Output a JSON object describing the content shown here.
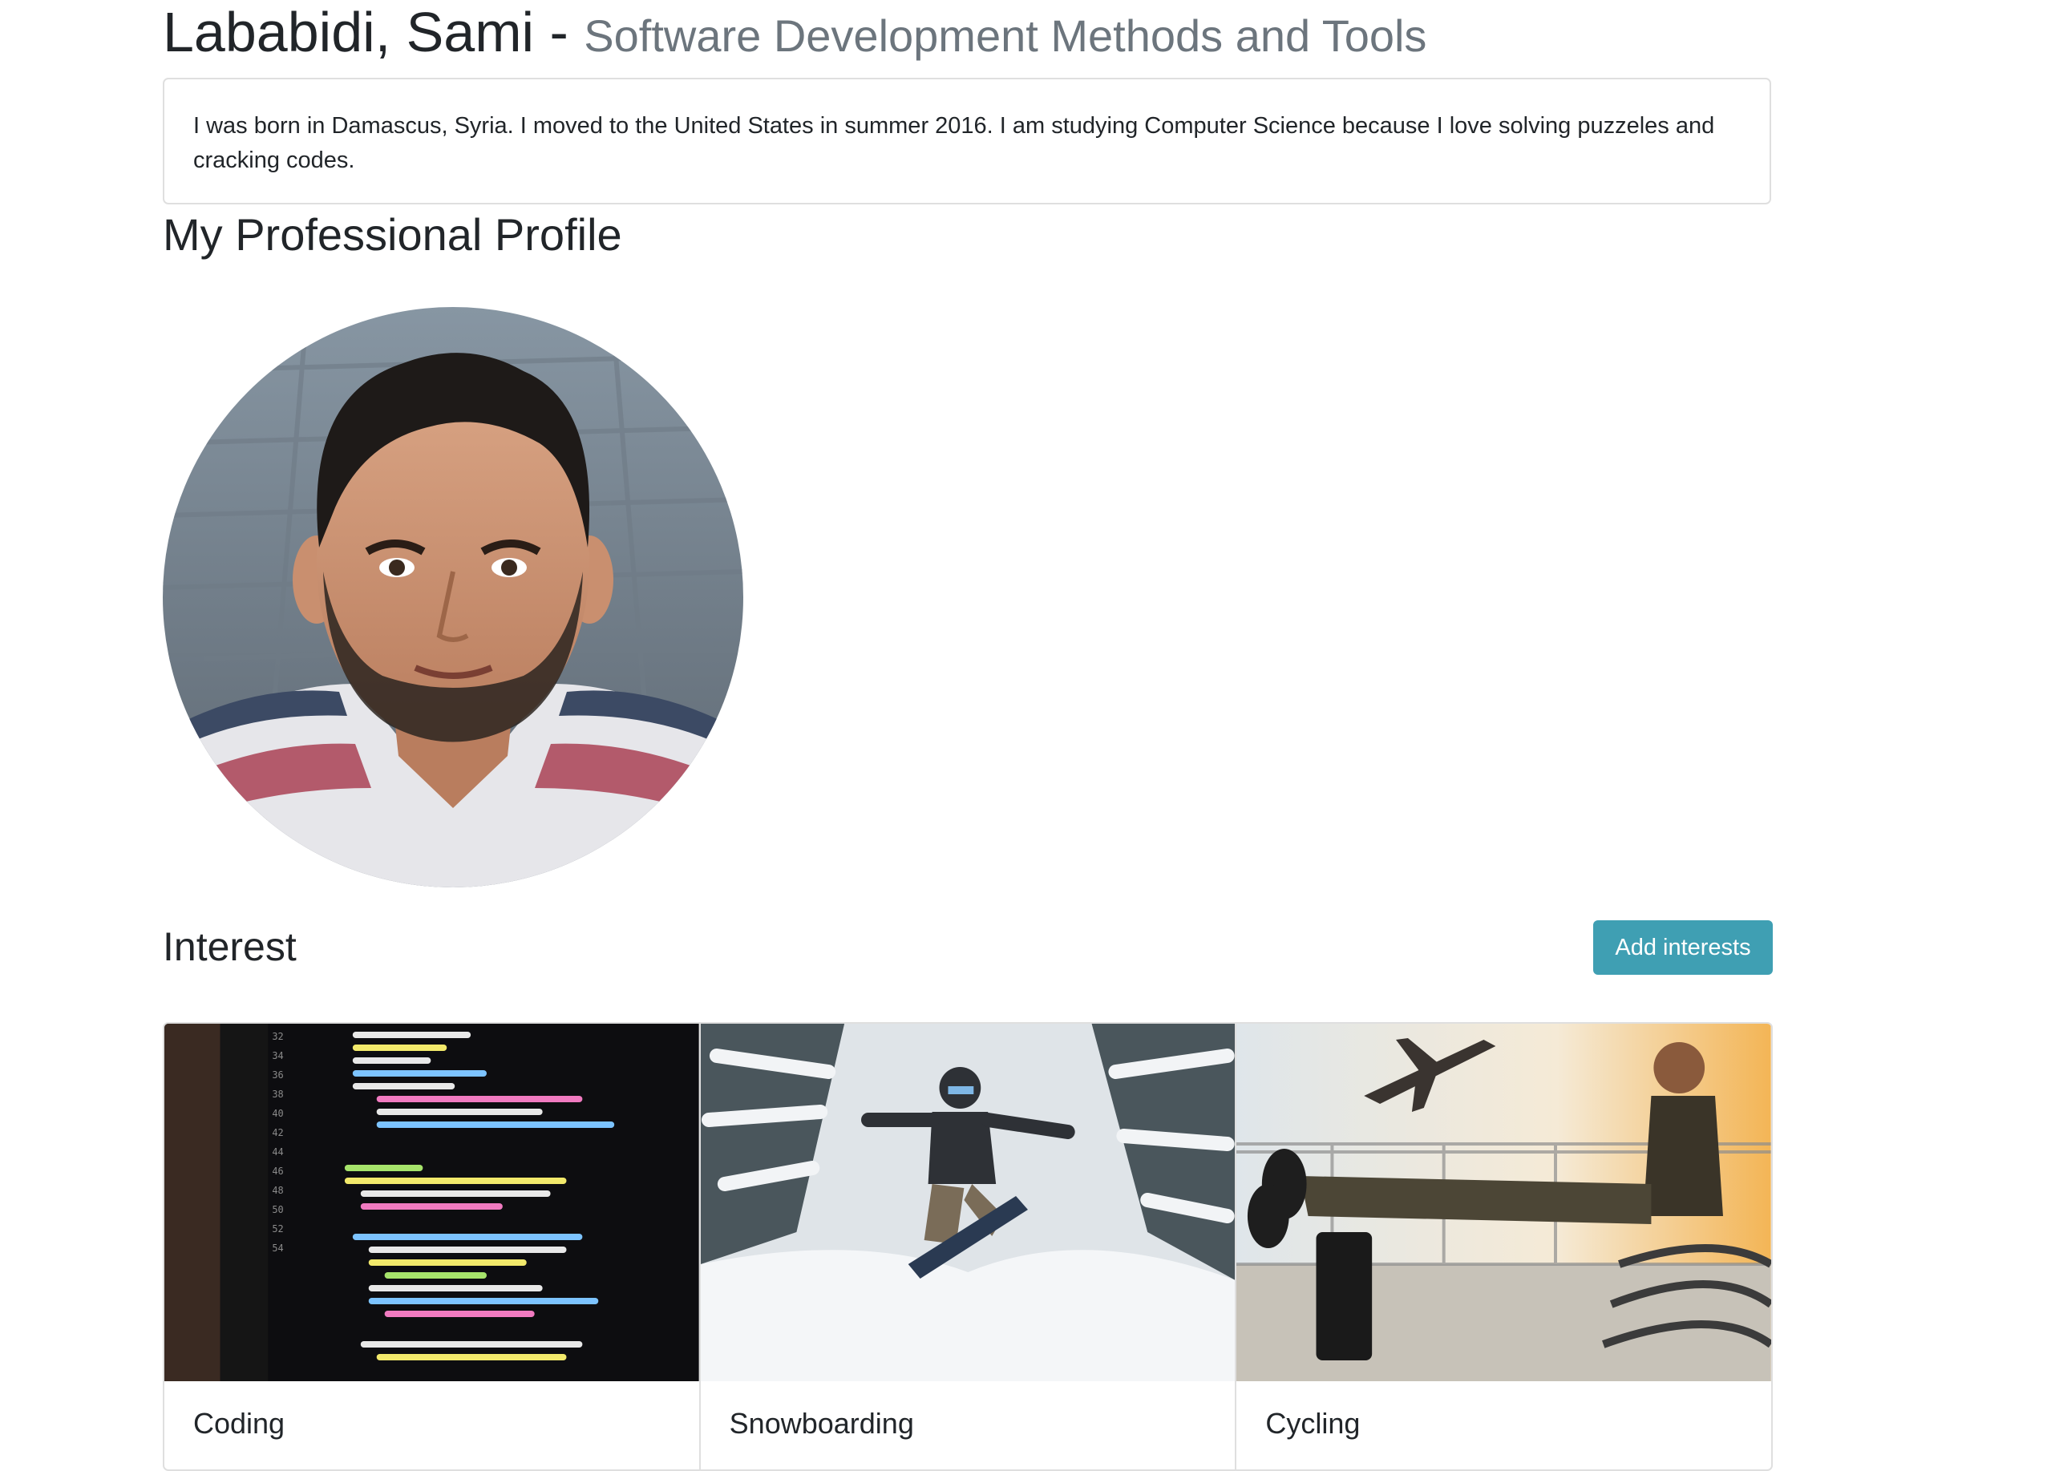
{
  "header": {
    "name": "Lababidi, Sami",
    "separator": " - ",
    "course": "Software Development Methods and Tools"
  },
  "bio": {
    "text": "I was born in Damascus, Syria. I moved to the United States in summer 2016. I am studying Computer Science because I love solving puzzeles and cracking codes."
  },
  "profile": {
    "heading": "My Professional Profile",
    "photo_icon": "profile-photo"
  },
  "interests": {
    "heading": "Interest",
    "add_button_label": "Add interests",
    "accent_color": "#3f9fb3",
    "items": [
      {
        "title": "Coding",
        "image_icon": "code-screen-image"
      },
      {
        "title": "Snowboarding",
        "image_icon": "snowboarder-image"
      },
      {
        "title": "Cycling",
        "image_icon": "airport-traveler-image"
      }
    ]
  }
}
